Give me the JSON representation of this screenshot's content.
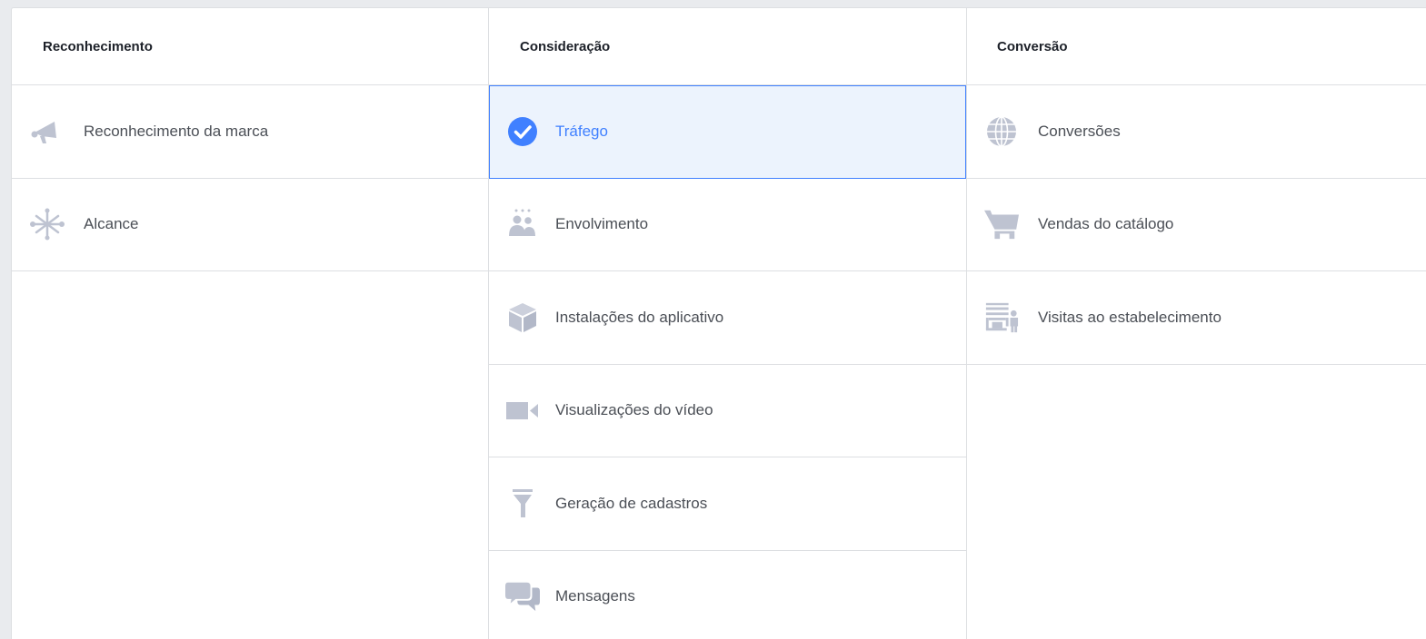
{
  "columns": [
    {
      "title": "Reconhecimento",
      "items": [
        {
          "label": "Reconhecimento da marca",
          "icon": "megaphone-icon"
        },
        {
          "label": "Alcance",
          "icon": "reach-icon"
        }
      ]
    },
    {
      "title": "Consideração",
      "items": [
        {
          "label": "Tráfego",
          "icon": "checkmark-circle-icon",
          "selected": true
        },
        {
          "label": "Envolvimento",
          "icon": "people-icon"
        },
        {
          "label": "Instalações do aplicativo",
          "icon": "box-icon"
        },
        {
          "label": "Visualizações do vídeo",
          "icon": "video-camera-icon"
        },
        {
          "label": "Geração de cadastros",
          "icon": "funnel-icon"
        },
        {
          "label": "Mensagens",
          "icon": "chat-bubbles-icon"
        }
      ]
    },
    {
      "title": "Conversão",
      "items": [
        {
          "label": "Conversões",
          "icon": "globe-icon"
        },
        {
          "label": "Vendas do catálogo",
          "icon": "cart-icon"
        },
        {
          "label": "Visitas ao estabelecimento",
          "icon": "store-icon"
        }
      ]
    }
  ],
  "colors": {
    "accent": "#4080ff",
    "selected_bg": "#ecf3fd",
    "icon_gray": "#bec3d1",
    "text": "#4b4f56",
    "header_text": "#1d2129",
    "border": "#dddfe2"
  }
}
